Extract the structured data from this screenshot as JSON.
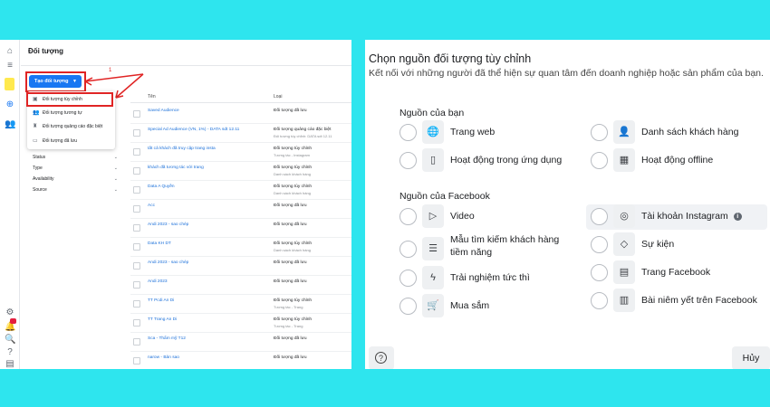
{
  "left": {
    "title": "Đối tượng",
    "create_button": "Tạo đối tượng",
    "step_number": "1",
    "dropdown": [
      {
        "label": "Đối tượng tùy chỉnh",
        "icon": "custom-audience-icon"
      },
      {
        "label": "Đối tượng tương tự",
        "icon": "lookalike-icon"
      },
      {
        "label": "Đối tượng quảng cáo đặc biệt",
        "icon": "special-ad-icon"
      },
      {
        "label": "Đối tượng đã lưu",
        "icon": "saved-audience-icon"
      }
    ],
    "filters": [
      "Status",
      "Type",
      "Availability",
      "Source"
    ],
    "table": {
      "headers": [
        "Tên",
        "Loại"
      ],
      "rows": [
        {
          "name": "Saved Audience",
          "type": "Đối tượng đã lưu",
          "sub": ""
        },
        {
          "name": "Special Ad Audience (VN, 1%) - DATA sdt 12.11",
          "type": "Đối tượng quảng cáo đặc biệt",
          "sub": "Đối tượng tùy chỉnh: DATA sdt 12.11"
        },
        {
          "name": "tất cả khách đã truy cập trang insta",
          "type": "Đối tượng tùy chỉnh",
          "sub": "Tương tác - Instagram"
        },
        {
          "name": "khách đã tương tác với trang",
          "type": "Đối tượng tùy chỉnh",
          "sub": "Danh sách khách hàng"
        },
        {
          "name": "Data A Quyền",
          "type": "Đối tượng tùy chỉnh",
          "sub": "Danh sách khách hàng"
        },
        {
          "name": "Acc",
          "type": "Đối tượng đã lưu",
          "sub": ""
        },
        {
          "name": "Andi 2023 - sao chép",
          "type": "Đối tượng đã lưu",
          "sub": ""
        },
        {
          "name": "Data KH DT",
          "type": "Đối tượng tùy chỉnh",
          "sub": "Danh sách khách hàng"
        },
        {
          "name": "Andi 2023 - sao chép",
          "type": "Đối tượng đã lưu",
          "sub": ""
        },
        {
          "name": "Andi 2023",
          "type": "Đối tượng đã lưu",
          "sub": ""
        },
        {
          "name": "TT Pcdi An Di",
          "type": "Đối tượng tùy chỉnh",
          "sub": "Tương tác - Trang"
        },
        {
          "name": "TT Trang An Di",
          "type": "Đối tượng tùy chỉnh",
          "sub": "Tương tác - Trang"
        },
        {
          "name": "Sca - Thẩm mỹ T12",
          "type": "Đối tượng đã lưu",
          "sub": ""
        },
        {
          "name": "narow - Bản sao",
          "type": "Đối tượng đã lưu",
          "sub": ""
        }
      ]
    },
    "accent_color": "#1877f2",
    "highlight_color": "#e02424"
  },
  "right": {
    "title": "Chọn nguồn đối tượng tùy chỉnh",
    "subtitle": "Kết nối với những người đã thể hiện sự quan tâm đến doanh nghiệp hoặc sản phẩm của bạn.",
    "section_your_sources": "Nguồn của bạn",
    "section_facebook_sources": "Nguồn của Facebook",
    "your_sources": [
      {
        "label": "Trang web",
        "icon": "globe-icon"
      },
      {
        "label": "Danh sách khách hàng",
        "icon": "customer-list-icon"
      },
      {
        "label": "Hoạt động trong ứng dụng",
        "icon": "mobile-app-icon"
      },
      {
        "label": "Hoạt động offline",
        "icon": "offline-store-icon"
      }
    ],
    "facebook_sources": [
      {
        "label": "Video",
        "icon": "play-icon"
      },
      {
        "label": "Tài khoản Instagram",
        "icon": "instagram-icon"
      },
      {
        "label": "Mẫu tìm kiếm khách hàng",
        "label2": "tiềm năng",
        "icon": "lead-form-icon"
      },
      {
        "label": "Sự kiện",
        "icon": "event-ticket-icon"
      },
      {
        "label": "Trải nghiệm tức thì",
        "icon": "lightning-icon"
      },
      {
        "label": "Trang Facebook",
        "icon": "facebook-page-icon"
      },
      {
        "label": "Mua sắm",
        "icon": "cart-icon"
      },
      {
        "label": "Bài niêm yết trên Facebook",
        "icon": "listing-icon"
      }
    ],
    "cancel_button": "Hủy",
    "help_glyph": "?"
  }
}
